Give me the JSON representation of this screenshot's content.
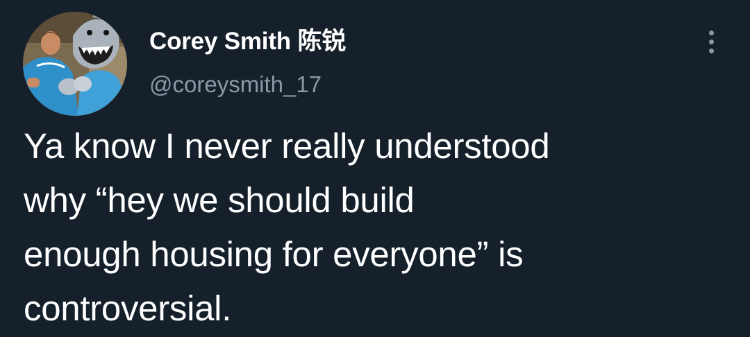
{
  "tweet": {
    "author": {
      "display_name": "Corey Smith 陈锐",
      "handle": "@coreysmith_17"
    },
    "text_lines": [
      "Ya know I never really understood",
      "why “hey we should build",
      "enough housing for everyone” is",
      "controversial."
    ],
    "more_icon": "more-vertical-icon"
  },
  "theme": {
    "background": "#15202b",
    "text": "#ffffff",
    "secondary_text": "#8b98a5"
  }
}
